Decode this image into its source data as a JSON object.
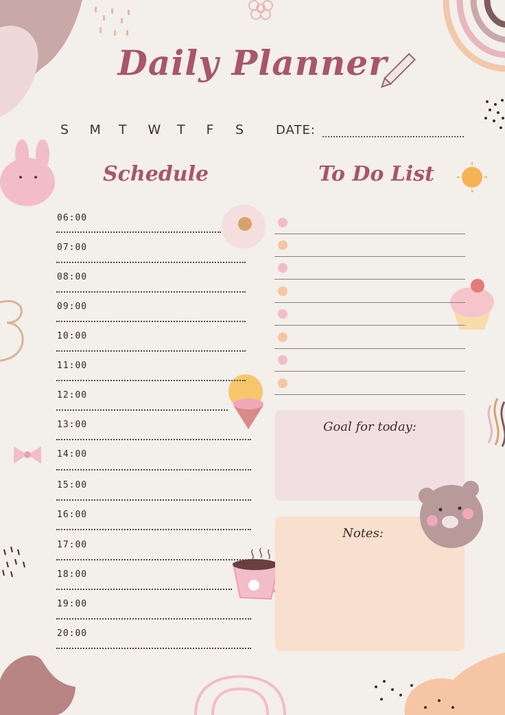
{
  "title": "Daily Planner",
  "weekdays": [
    "S",
    "M",
    "T",
    "W",
    "T",
    "F",
    "S"
  ],
  "date_label": "DATE:",
  "schedule": {
    "heading": "Schedule",
    "times": [
      "06:00",
      "07:00",
      "08:00",
      "09:00",
      "10:00",
      "11:00",
      "12:00",
      "13:00",
      "14:00",
      "15:00",
      "16:00",
      "17:00",
      "18:00",
      "19:00",
      "20:00"
    ]
  },
  "todo": {
    "heading": "To Do List",
    "dot_colors": [
      "#f2bdc8",
      "#f6c6a4",
      "#f2bdc8",
      "#f6c6a4",
      "#f2bdc8",
      "#f6c6a4",
      "#f2bdc8",
      "#f6c6a4"
    ]
  },
  "goal": {
    "label": "Goal for today:",
    "color": "#f1dfe1"
  },
  "notes": {
    "label": "Notes:",
    "color": "#f9dfcd"
  },
  "colors": {
    "accent": "#a8566a",
    "background": "#f3efeb"
  }
}
